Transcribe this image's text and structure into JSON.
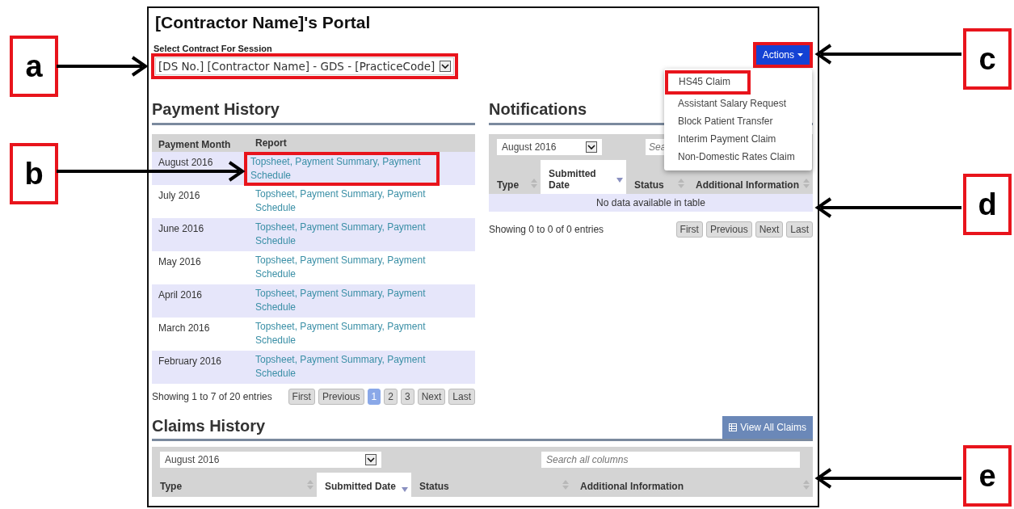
{
  "page_title": "[Contractor Name]'s Portal",
  "contract_select": {
    "label": "Select Contract For Session",
    "value": "[DS No.] [Contractor Name] - GDS - [PracticeCode]",
    "highlighted": true
  },
  "actions_button": {
    "label": "Actions",
    "highlighted": true
  },
  "actions_menu": [
    {
      "label": "HS45 Claim",
      "highlighted": true
    },
    {
      "label": "Assistant Salary Request",
      "highlighted": false
    },
    {
      "label": "Block Patient Transfer",
      "highlighted": false
    },
    {
      "label": "Interim Payment Claim",
      "highlighted": false
    },
    {
      "label": "Non-Domestic Rates Claim",
      "highlighted": false
    }
  ],
  "payment_history": {
    "title": "Payment History",
    "columns": [
      "Payment Month",
      "Report"
    ],
    "rows": [
      {
        "month": "August 2016",
        "report": "Topsheet, Payment Summary, Payment Schedule",
        "highlighted": true
      },
      {
        "month": "July 2016",
        "report": "Topsheet, Payment Summary, Payment Schedule",
        "highlighted": false
      },
      {
        "month": "June 2016",
        "report": "Topsheet, Payment Summary, Payment Schedule",
        "highlighted": false
      },
      {
        "month": "May 2016",
        "report": "Topsheet, Payment Summary, Payment Schedule",
        "highlighted": false
      },
      {
        "month": "April 2016",
        "report": "Topsheet, Payment Summary, Payment Schedule",
        "highlighted": false
      },
      {
        "month": "March 2016",
        "report": "Topsheet, Payment Summary, Payment Schedule",
        "highlighted": false
      },
      {
        "month": "February 2016",
        "report": "Topsheet, Payment Summary, Payment Schedule",
        "highlighted": false
      }
    ],
    "info": "Showing 1 to 7 of 20 entries",
    "pager": [
      {
        "label": "First",
        "selected": false
      },
      {
        "label": "Previous",
        "selected": false
      },
      {
        "label": "1",
        "selected": true
      },
      {
        "label": "2",
        "selected": false
      },
      {
        "label": "3",
        "selected": false
      },
      {
        "label": "Next",
        "selected": false
      },
      {
        "label": "Last",
        "selected": false
      }
    ]
  },
  "notifications": {
    "title": "Notifications",
    "filter": "August 2016",
    "search_placeholder": "Sea",
    "columns": [
      {
        "label": "Type",
        "sorted": false
      },
      {
        "label": "Submitted Date",
        "sorted": true
      },
      {
        "label": "Status",
        "sorted": false
      },
      {
        "label": "Additional Information",
        "sorted": false
      }
    ],
    "empty_message": "No data available in table",
    "info": "Showing 0 to 0 of 0 entries",
    "pager": [
      {
        "label": "First",
        "selected": false
      },
      {
        "label": "Previous",
        "selected": false
      },
      {
        "label": "Next",
        "selected": false
      },
      {
        "label": "Last",
        "selected": false
      }
    ]
  },
  "claims_history": {
    "title": "Claims History",
    "view_all_button": "View All Claims",
    "filter": "August 2016",
    "search_placeholder": "Search all columns",
    "columns": [
      {
        "label": "Type",
        "sorted": false
      },
      {
        "label": "Submitted Date",
        "sorted": true
      },
      {
        "label": "Status",
        "sorted": false
      },
      {
        "label": "Additional Information",
        "sorted": false
      }
    ]
  },
  "annotations": [
    {
      "letter": "a"
    },
    {
      "letter": "b"
    },
    {
      "letter": "c"
    },
    {
      "letter": "d"
    },
    {
      "letter": "e"
    }
  ]
}
